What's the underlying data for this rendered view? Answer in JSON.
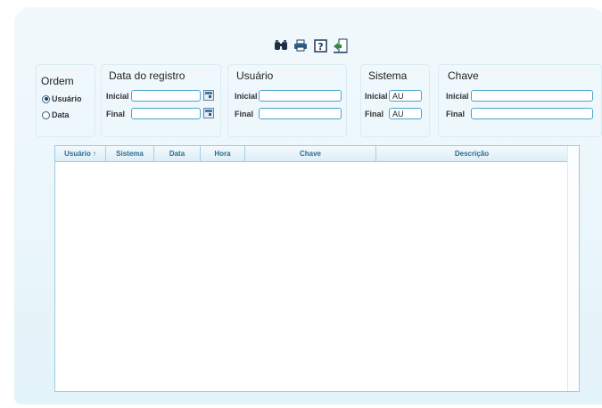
{
  "toolbar": {
    "icons": [
      "binoculars-icon",
      "printer-icon",
      "help-icon",
      "exit-icon"
    ]
  },
  "filters": {
    "ordem": {
      "title": "Ordem",
      "options": [
        "Usuário",
        "Data"
      ],
      "selected": "Usuário"
    },
    "data_registro": {
      "title": "Data do registro",
      "inicial_label": "Inicial",
      "final_label": "Final",
      "inicial_value": "",
      "final_value": ""
    },
    "usuario": {
      "title": "Usuário",
      "inicial_label": "Inicial",
      "final_label": "Final",
      "inicial_value": "",
      "final_value": ""
    },
    "sistema": {
      "title": "Sistema",
      "inicial_label": "Inicial",
      "final_label": "Final",
      "inicial_value": "AU",
      "final_value": "AU"
    },
    "chave": {
      "title": "Chave",
      "inicial_label": "Inicial",
      "final_label": "Final",
      "inicial_value": "",
      "final_value": ""
    }
  },
  "table": {
    "columns": [
      "Usuário",
      "Sistema",
      "Data",
      "Hora",
      "Chave",
      "Descrição"
    ],
    "sorted_column": "Usuário",
    "rows": []
  }
}
